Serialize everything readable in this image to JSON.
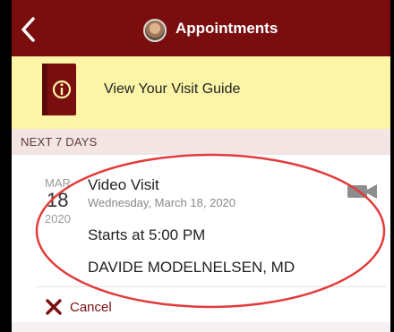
{
  "header": {
    "title": "Appointments",
    "back_icon": "chevron-left-icon",
    "avatar_icon": "avatar"
  },
  "guide": {
    "label": "View Your Visit Guide",
    "icon": "guide-book-icon"
  },
  "section": {
    "label": "NEXT 7 DAYS"
  },
  "appointment": {
    "month": "MAR",
    "day": "18",
    "year": "2020",
    "type": "Video Visit",
    "date_full": "Wednesday, March 18, 2020",
    "time": "Starts at 5:00 PM",
    "provider": "DAVIDE MODELNELSEN, MD",
    "type_icon": "video-camera-icon",
    "cancel_label": "Cancel",
    "cancel_icon": "close-x-icon"
  },
  "colors": {
    "header_bg": "#7a0e0e",
    "guide_bg": "#fcf4a6",
    "accent": "#7a0e0e",
    "annotation_oval": "#e23b3b"
  }
}
